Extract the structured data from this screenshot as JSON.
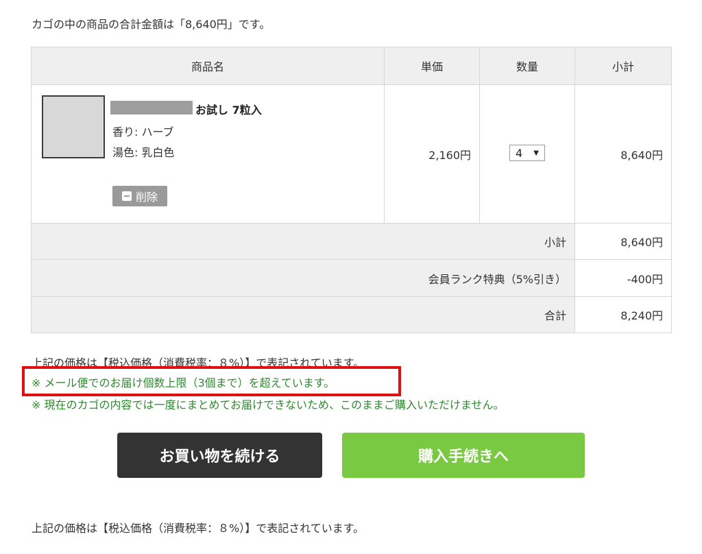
{
  "summary": {
    "total_message": "カゴの中の商品の合計金額は「8,640円」です。"
  },
  "table": {
    "headers": {
      "product": "商品名",
      "unit_price": "単価",
      "quantity": "数量",
      "subtotal": "小計"
    },
    "item": {
      "name": "お試し 7粒入",
      "scent": "香り: ハーブ",
      "bath_color": "湯色: 乳白色",
      "delete_label": "削除",
      "unit_price": "2,160円",
      "quantity": "4",
      "subtotal": "8,640円"
    },
    "summary_rows": [
      {
        "label": "小計",
        "amount": "8,640円"
      },
      {
        "label": "会員ランク特典（5%引き）",
        "amount": "-400円"
      },
      {
        "label": "合計",
        "amount": "8,240円"
      }
    ]
  },
  "notes": {
    "tax_note": "上記の価格は【税込価格（消費税率：８%）】で表記されています。",
    "warning_limit": "※ メール便でのお届け個数上限（3個まで）を超えています。",
    "warning_no_purchase": "※ 現在のカゴの内容では一度にまとめてお届けできないため、このままご購入いただけません。"
  },
  "buttons": {
    "continue_shopping": "お買い物を続ける",
    "checkout": "購入手続きへ"
  },
  "colors": {
    "warning_text": "#2f8a2f",
    "highlight_border": "#e01010",
    "checkout_button": "#7ac943",
    "continue_button": "#333333"
  }
}
